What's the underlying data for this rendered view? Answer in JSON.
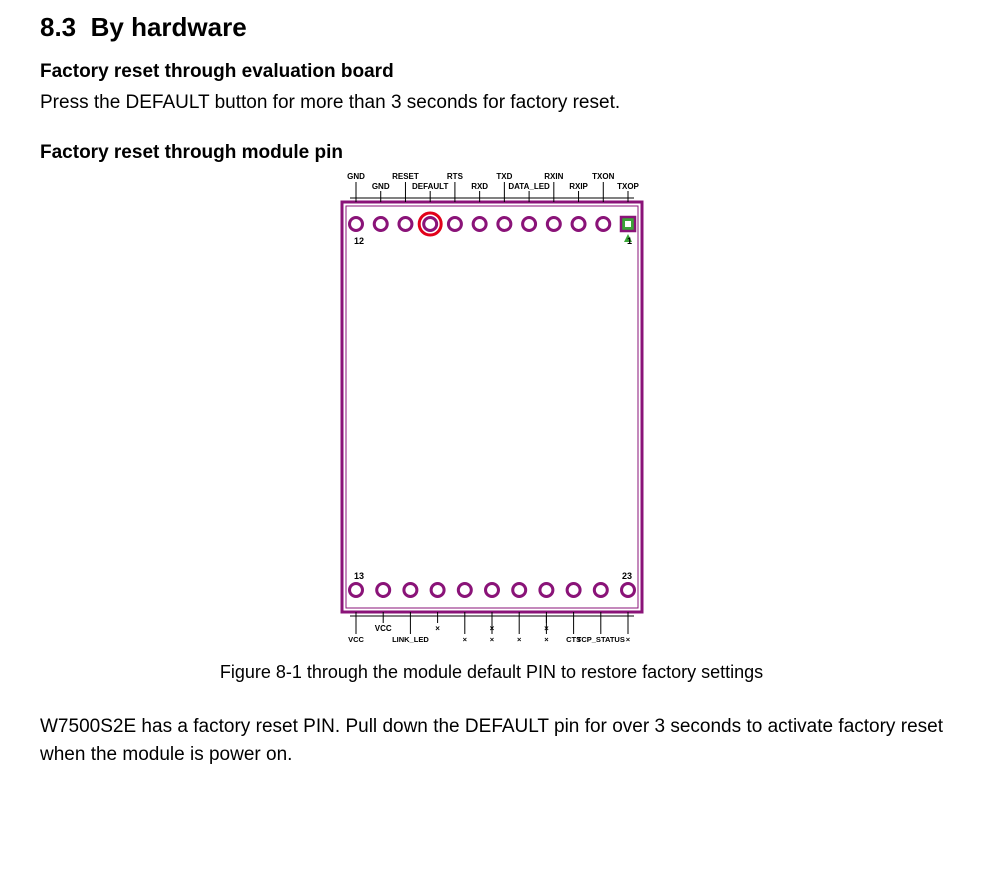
{
  "section_number": "8.3",
  "section_title": "By hardware",
  "sub1_title": "Factory reset through evaluation board",
  "sub1_body": "Press the DEFAULT button for more than 3 seconds for factory reset.",
  "sub2_title": "Factory reset through module pin",
  "figure_caption": "Figure 8-1 through the module default PIN to restore factory settings",
  "final_body": "W7500S2E has a factory reset PIN. Pull down the DEFAULT pin for over 3 seconds to activate factory reset when the module is power on.",
  "diagram": {
    "top_pins_upper": [
      "GND",
      "RESET",
      "RTS",
      "TXD",
      "RXIN",
      "TXON"
    ],
    "top_pins_lower": [
      "GND",
      "DEFAULT",
      "RXD",
      "DATA_LED",
      "RXIP",
      "TXOP"
    ],
    "bottom_pins_lower": [
      "VCC",
      "LINK_LED",
      "×",
      "×",
      "×",
      "×",
      "CTS",
      "TCP_STATUS",
      "×"
    ],
    "bottom_pins_upper": [
      "VCC",
      "×",
      "×",
      "×"
    ],
    "corner_labels": {
      "top_left": "12",
      "top_right": "1",
      "bottom_left": "13",
      "bottom_right": "23"
    },
    "highlight_pin": "DEFAULT",
    "colors": {
      "board_outline": "#8a1378",
      "pad": "#8a1378",
      "highlight": "#e2001a",
      "pin1_fill": "#3aa537"
    }
  }
}
